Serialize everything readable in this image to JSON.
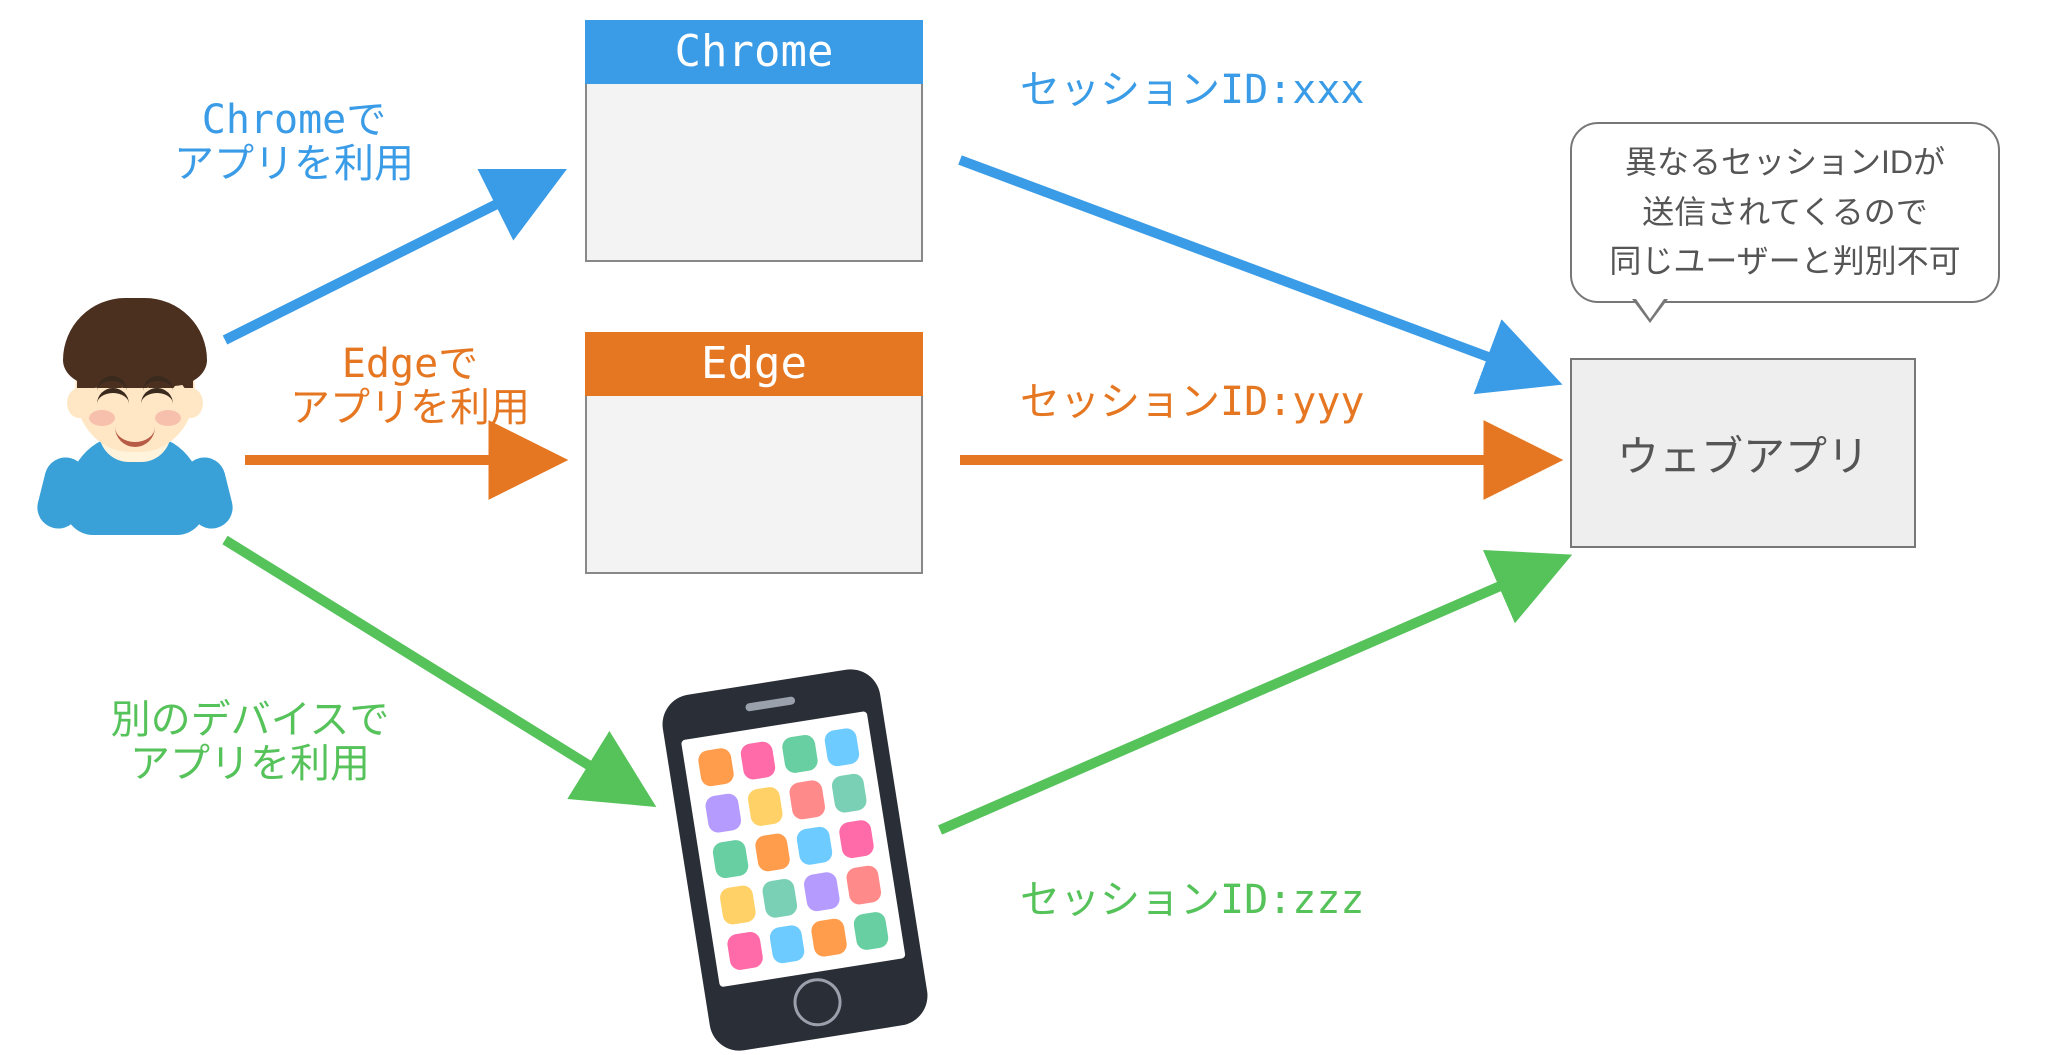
{
  "colors": {
    "blue": "#3a9be6",
    "orange": "#e67722",
    "green": "#55c25a",
    "gray_border": "#888888",
    "gray_text": "#555555",
    "box_fill": "#f3f3f3"
  },
  "user_labels": {
    "chrome": "Chromeで\nアプリを利用",
    "edge": "Edgeで\nアプリを利用",
    "device": "別のデバイスで\nアプリを利用"
  },
  "browsers": {
    "chrome": {
      "title": "Chrome"
    },
    "edge": {
      "title": "Edge"
    }
  },
  "sessions": {
    "chrome": "セッションID:xxx",
    "edge": "セッションID:yyy",
    "device": "セッションID:zzz"
  },
  "webapp": {
    "label": "ウェブアプリ"
  },
  "bubble_lines": [
    "異なるセッションIDが",
    "送信されてくるので",
    "同じユーザーと判別不可"
  ]
}
